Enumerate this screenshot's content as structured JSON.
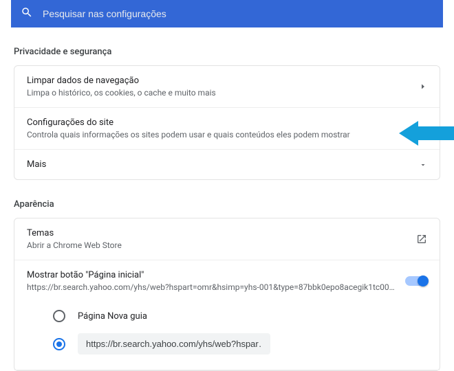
{
  "search": {
    "placeholder": "Pesquisar nas configurações"
  },
  "privacy": {
    "section_title": "Privacidade e segurança",
    "clear": {
      "title": "Limpar dados de navegação",
      "sub": "Limpa o histórico, os cookies, o cache e muito mais"
    },
    "site": {
      "title": "Configurações do site",
      "sub": "Controla quais informações os sites podem usar e quais conteúdos eles podem mostrar"
    },
    "more": "Mais"
  },
  "appearance": {
    "section_title": "Aparência",
    "themes": {
      "title": "Temas",
      "sub": "Abrir a Chrome Web Store"
    },
    "home_button": {
      "title": "Mostrar botão \"Página inicial\"",
      "sub": "https://br.search.yahoo.com/yhs/web?hspart=omr&hsimp=yhs-001&type=87bbk0epo8acegik1tc00…",
      "toggle_on": true
    },
    "home_radio": {
      "option_newtab": "Página Nova guia",
      "option_url_value": "https://br.search.yahoo.com/yhs/web?hspar…",
      "selected": "url"
    }
  }
}
